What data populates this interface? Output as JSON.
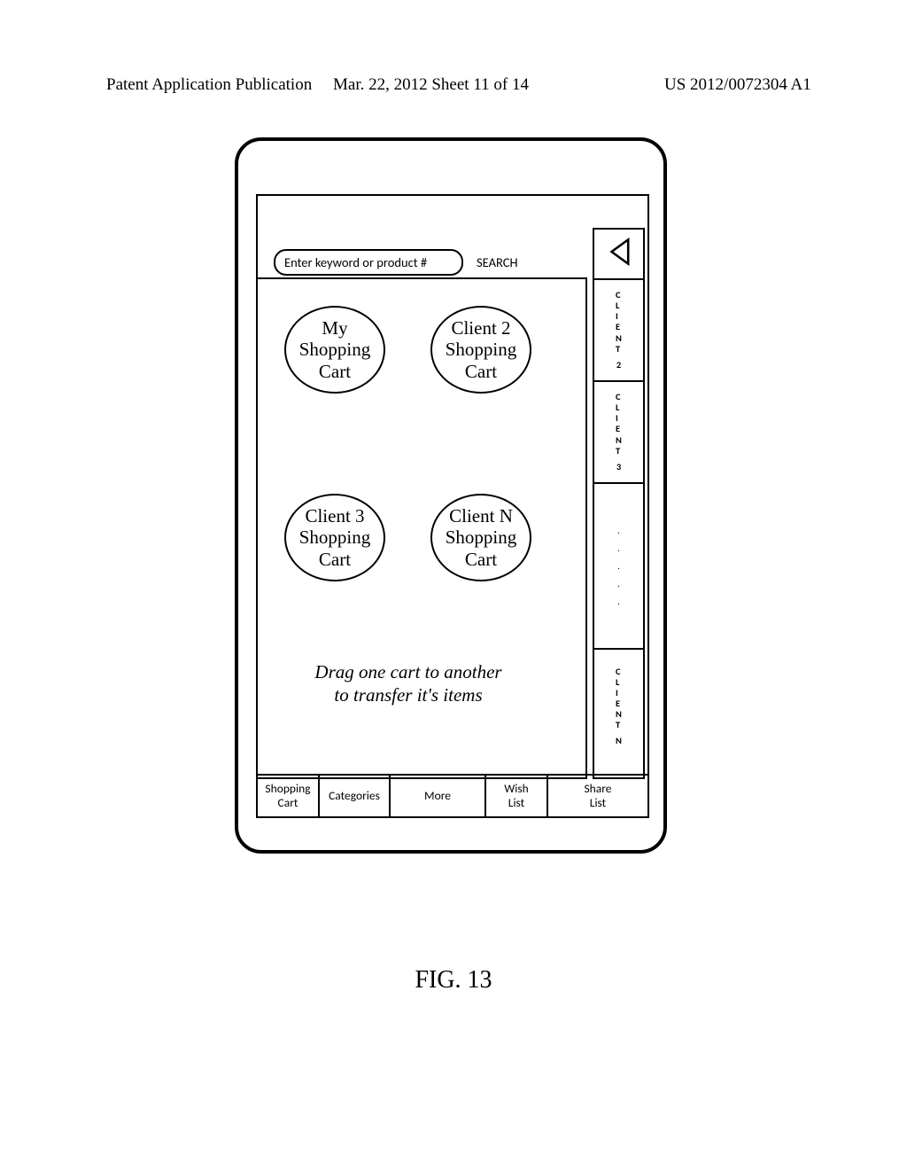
{
  "header": {
    "left": "Patent Application Publication",
    "center": "Mar. 22, 2012  Sheet 11 of 14",
    "right": "US 2012/0072304 A1"
  },
  "search": {
    "placeholder": "Enter keyword or product #",
    "button": "SEARCH"
  },
  "carts": {
    "my": {
      "l1": "My",
      "l2": "Shopping",
      "l3": "Cart"
    },
    "c2": {
      "l1": "Client 2",
      "l2": "Shopping",
      "l3": "Cart"
    },
    "c3": {
      "l1": "Client 3",
      "l2": "Shopping",
      "l3": "Cart"
    },
    "cn": {
      "l1": "Client N",
      "l2": "Shopping",
      "l3": "Cart"
    }
  },
  "instruction": {
    "l1": "Drag one cart to another",
    "l2": "to transfer it's items"
  },
  "sidebar": {
    "client2": {
      "c": "C",
      "l": "L",
      "i": "I",
      "e": "E",
      "n": "N",
      "t": "T",
      "num": "2"
    },
    "client3": {
      "c": "C",
      "l": "L",
      "i": "I",
      "e": "E",
      "n": "N",
      "t": "T",
      "num": "3"
    },
    "clientn": {
      "c": "C",
      "l": "L",
      "i": "I",
      "e": "E",
      "n": "N",
      "t": "T",
      "num": "N"
    }
  },
  "tabs": {
    "t1a": "Shopping",
    "t1b": "Cart",
    "t2": "Categories",
    "t3": "More",
    "t4a": "Wish",
    "t4b": "List",
    "t5a": "Share",
    "t5b": "List"
  },
  "figure": "FIG. 13"
}
